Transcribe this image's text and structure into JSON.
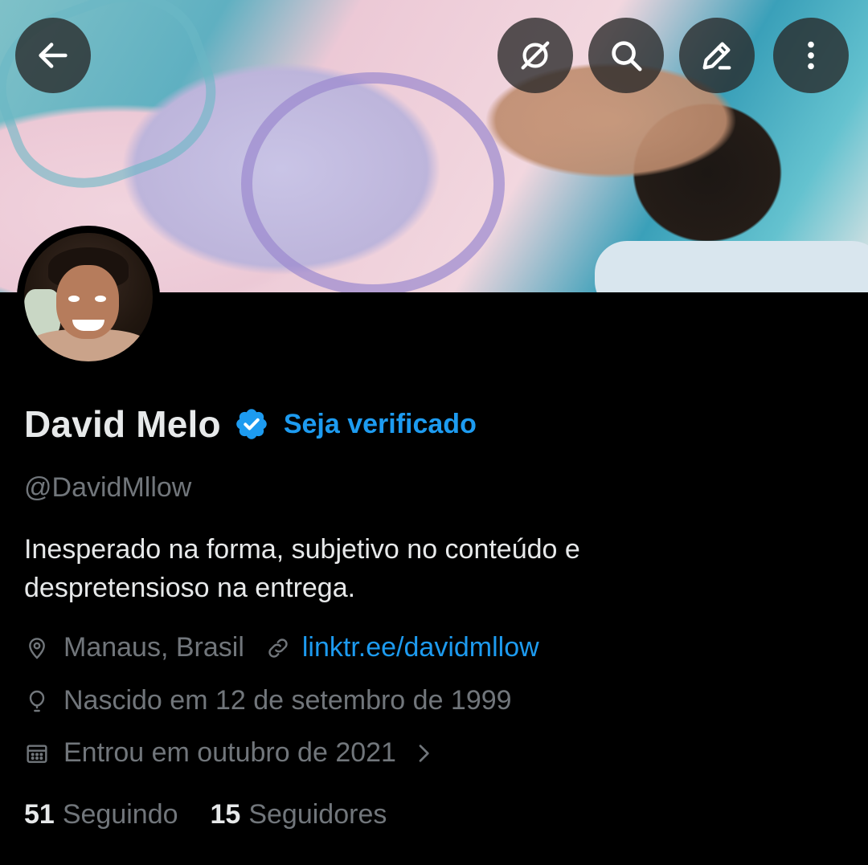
{
  "header": {
    "back_icon": "arrow-left-icon",
    "grok_icon": "grok-icon",
    "search_icon": "search-icon",
    "edit_icon": "edit-icon",
    "more_icon": "more-vertical-icon"
  },
  "profile": {
    "name": "David Melo",
    "verify_link": "Seja verificado",
    "handle": "@DavidMllow",
    "bio_lines": [
      "Inesperado na forma, subjetivo no conteúdo e",
      "despretensioso na entrega."
    ],
    "location": "Manaus, Brasil",
    "website": "linktr.ee/davidmllow",
    "birthday": "Nascido em 12 de setembro de 1999",
    "joined": "Entrou em outubro de 2021",
    "following_count": "51",
    "following_label": "Seguindo",
    "followers_count": "15",
    "followers_label": "Seguidores"
  },
  "colors": {
    "background": "#000000",
    "text_primary": "#e7e9ea",
    "text_secondary": "#71767b",
    "accent": "#1d9bf0"
  }
}
